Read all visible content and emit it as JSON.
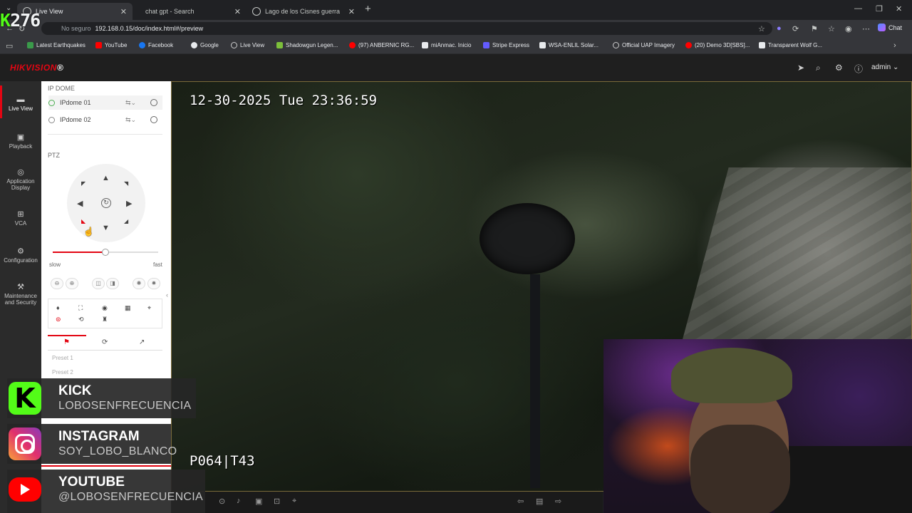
{
  "browser": {
    "tabs": [
      {
        "title": "Live View"
      },
      {
        "title": "chat gpt - Search"
      },
      {
        "title": "Lago de los Cisnes guerra"
      }
    ],
    "security_label": "No seguro",
    "url": "192.168.0.15/doc/index.html#/preview",
    "chat_label": "Chat",
    "bookmarks": [
      "Latest Earthquakes",
      "YouTube",
      "Facebook",
      "Google",
      "Live View",
      "Shadowgun Legen...",
      "(97) ANBERNIC RG...",
      "miAnmac. Inicio",
      "Stripe Express",
      "WSA-ENLIL Solar...",
      "Official UAP Imagery",
      "(20) Demo 3D[SBS]...",
      "Transparent Wolf G..."
    ]
  },
  "overlay": {
    "kick_count_prefix": "K",
    "kick_count": "276"
  },
  "app": {
    "brand": "HIKVISION",
    "brand_mark": "®",
    "user": "admin"
  },
  "sidebar": {
    "items": [
      {
        "label": "Live View"
      },
      {
        "label": "Playback"
      },
      {
        "label": "Application Display"
      },
      {
        "label": "VCA"
      },
      {
        "label": "Configuration"
      },
      {
        "label": "Maintenance and Security"
      }
    ]
  },
  "panel": {
    "group_title": "IP DOME",
    "cameras": [
      "IPdome 01",
      "IPdome 02"
    ],
    "ptz_title": "PTZ",
    "speed_slow": "slow",
    "speed_fast": "fast",
    "speed_level": 0.5,
    "presets": [
      "Preset 1",
      "Preset 2"
    ]
  },
  "video": {
    "osd_time": "12-30-2025 Tue 23:36:59",
    "osd_ptz": "P064|T43"
  },
  "social": {
    "kick": {
      "title": "KICK",
      "handle": "LOBOSENFRECUENCIA"
    },
    "instagram": {
      "title": "INSTAGRAM",
      "handle": "SOY_LOBO_BLANCO"
    },
    "youtube": {
      "title": "YOUTUBE",
      "handle": "@LOBOSENFRECUENCIA"
    }
  },
  "colors": {
    "accent": "#e30613",
    "kick": "#53fc18"
  }
}
